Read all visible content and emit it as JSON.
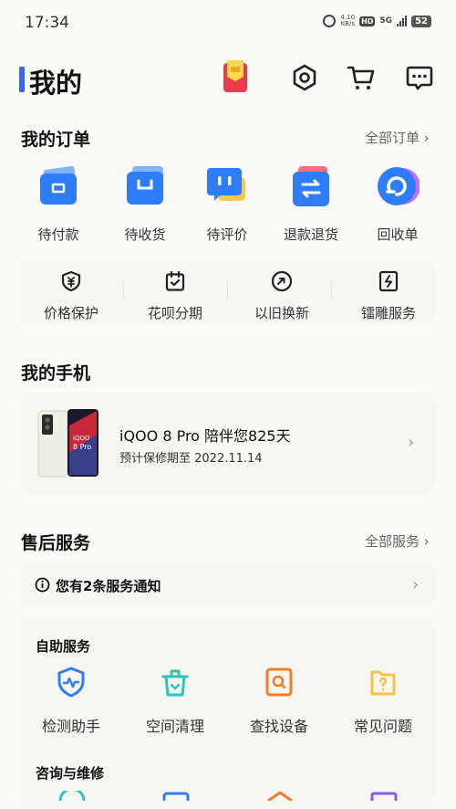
{
  "status_bar": {
    "time": "17:34",
    "speed": "4.10",
    "speed_unit": "KB/s",
    "hd": "HD",
    "network": "5G",
    "battery": "52"
  },
  "header": {
    "title": "我的"
  },
  "orders": {
    "title": "我的订单",
    "more": "全部订单",
    "items": [
      {
        "label": "待付款",
        "icon": "wallet-icon"
      },
      {
        "label": "待收货",
        "icon": "box-icon"
      },
      {
        "label": "待评价",
        "icon": "comment-icon"
      },
      {
        "label": "退款退货",
        "icon": "exchange-icon"
      },
      {
        "label": "回收单",
        "icon": "recycle-icon"
      }
    ]
  },
  "services": {
    "items": [
      {
        "label": "价格保护",
        "icon": "price-protect-icon"
      },
      {
        "label": "花呗分期",
        "icon": "calendar-icon"
      },
      {
        "label": "以旧换新",
        "icon": "trade-in-icon"
      },
      {
        "label": "镭雕服务",
        "icon": "engrave-icon"
      }
    ]
  },
  "phone": {
    "title": "我的手机",
    "name": "iQOO 8 Pro 陪伴您825天",
    "warranty": "预计保修期至 2022.11.14",
    "image_text": "iQOO 8 Pro"
  },
  "after_sales": {
    "title": "售后服务",
    "more": "全部服务",
    "notice": "您有2条服务通知",
    "self_service": {
      "title": "自助服务",
      "items": [
        {
          "label": "检测助手",
          "icon": "detect-icon"
        },
        {
          "label": "空间清理",
          "icon": "clean-icon"
        },
        {
          "label": "查找设备",
          "icon": "find-device-icon"
        },
        {
          "label": "常见问题",
          "icon": "faq-icon"
        }
      ]
    },
    "consult_title": "咨询与维修"
  },
  "colors": {
    "accent": "#3a67f0",
    "blue": "#2f7df6",
    "teal": "#2ec4b6",
    "orange": "#ef7d2c",
    "yellow": "#f5c343",
    "purple": "#8a56e8"
  }
}
